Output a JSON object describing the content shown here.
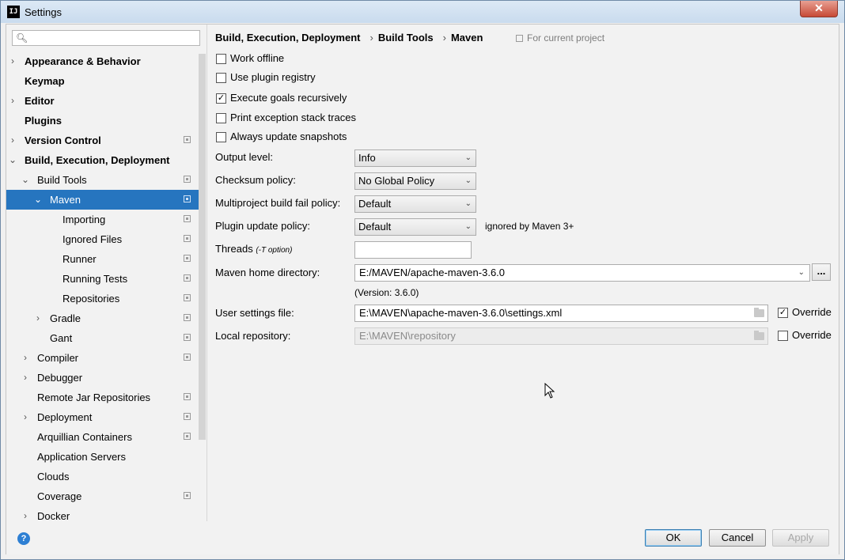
{
  "window": {
    "title": "Settings",
    "app_icon_text": "IJ",
    "close_glyph": "✕"
  },
  "sidebar": {
    "search": {
      "placeholder": "",
      "value": ""
    },
    "items": [
      {
        "label": "Appearance & Behavior",
        "level": 0,
        "bold": true,
        "arrow": "›",
        "proj": false
      },
      {
        "label": "Keymap",
        "level": 0,
        "bold": true,
        "arrow": "",
        "proj": false
      },
      {
        "label": "Editor",
        "level": 0,
        "bold": true,
        "arrow": "›",
        "proj": false
      },
      {
        "label": "Plugins",
        "level": 0,
        "bold": true,
        "arrow": "",
        "proj": false
      },
      {
        "label": "Version Control",
        "level": 0,
        "bold": true,
        "arrow": "›",
        "proj": true
      },
      {
        "label": "Build, Execution, Deployment",
        "level": 0,
        "bold": true,
        "arrow": "⌄",
        "proj": false
      },
      {
        "label": "Build Tools",
        "level": 1,
        "bold": false,
        "arrow": "⌄",
        "proj": true
      },
      {
        "label": "Maven",
        "level": 2,
        "bold": false,
        "arrow": "⌄",
        "proj": true,
        "selected": true
      },
      {
        "label": "Importing",
        "level": 3,
        "bold": false,
        "arrow": "",
        "proj": true
      },
      {
        "label": "Ignored Files",
        "level": 3,
        "bold": false,
        "arrow": "",
        "proj": true
      },
      {
        "label": "Runner",
        "level": 3,
        "bold": false,
        "arrow": "",
        "proj": true
      },
      {
        "label": "Running Tests",
        "level": 3,
        "bold": false,
        "arrow": "",
        "proj": true
      },
      {
        "label": "Repositories",
        "level": 3,
        "bold": false,
        "arrow": "",
        "proj": true
      },
      {
        "label": "Gradle",
        "level": 2,
        "bold": false,
        "arrow": "›",
        "proj": true
      },
      {
        "label": "Gant",
        "level": 2,
        "bold": false,
        "arrow": "",
        "proj": true
      },
      {
        "label": "Compiler",
        "level": 1,
        "bold": false,
        "arrow": "›",
        "proj": true
      },
      {
        "label": "Debugger",
        "level": 1,
        "bold": false,
        "arrow": "›",
        "proj": false
      },
      {
        "label": "Remote Jar Repositories",
        "level": 1,
        "bold": false,
        "arrow": "",
        "proj": true
      },
      {
        "label": "Deployment",
        "level": 1,
        "bold": false,
        "arrow": "›",
        "proj": true
      },
      {
        "label": "Arquillian Containers",
        "level": 1,
        "bold": false,
        "arrow": "",
        "proj": true
      },
      {
        "label": "Application Servers",
        "level": 1,
        "bold": false,
        "arrow": "",
        "proj": false
      },
      {
        "label": "Clouds",
        "level": 1,
        "bold": false,
        "arrow": "",
        "proj": false
      },
      {
        "label": "Coverage",
        "level": 1,
        "bold": false,
        "arrow": "",
        "proj": true
      },
      {
        "label": "Docker",
        "level": 1,
        "bold": false,
        "arrow": "›",
        "proj": false
      }
    ]
  },
  "breadcrumb": {
    "part1": "Build, Execution, Deployment",
    "sep": "›",
    "part2": "Build Tools",
    "part3": "Maven",
    "scope": "For current project"
  },
  "checkboxes": {
    "work_offline": {
      "label": "Work offline",
      "checked": false
    },
    "use_plugin_registry": {
      "label": "Use plugin registry",
      "checked": false
    },
    "execute_goals": {
      "label": "Execute goals recursively",
      "checked": true
    },
    "print_exception": {
      "label": "Print exception stack traces",
      "checked": false
    },
    "always_update": {
      "label": "Always update snapshots",
      "checked": false
    }
  },
  "form": {
    "output_level": {
      "label": "Output level:",
      "value": "Info"
    },
    "checksum_policy": {
      "label": "Checksum policy:",
      "value": "No Global Policy"
    },
    "multiproject": {
      "label": "Multiproject build fail policy:",
      "value": "Default"
    },
    "plugin_update": {
      "label": "Plugin update policy:",
      "value": "Default",
      "note": "ignored by Maven 3+"
    },
    "threads": {
      "label": "Threads",
      "hint": "(-T option)",
      "value": ""
    },
    "maven_home": {
      "label": "Maven home directory:",
      "value": "E:/MAVEN/apache-maven-3.6.0",
      "browse": "...",
      "version": "(Version: 3.6.0)"
    },
    "user_settings": {
      "label": "User settings file:",
      "value": "E:\\MAVEN\\apache-maven-3.6.0\\settings.xml",
      "override_label": "Override",
      "override_checked": true
    },
    "local_repo": {
      "label": "Local repository:",
      "value": "E:\\MAVEN\\repository",
      "override_label": "Override",
      "override_checked": false
    }
  },
  "footer": {
    "help": "?",
    "ok": "OK",
    "cancel": "Cancel",
    "apply": "Apply"
  },
  "chevron_glyph": "⌄",
  "check_glyph": "✓",
  "colors": {
    "selection": "#2675bf",
    "accent": "#2d7fd3"
  }
}
